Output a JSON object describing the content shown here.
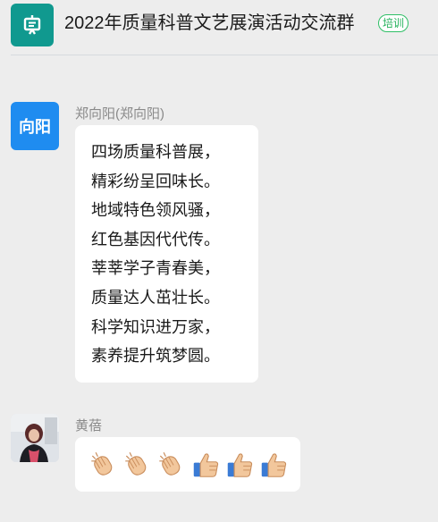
{
  "header": {
    "title": "2022年质量科普文艺展演活动交流群",
    "tag": "培训"
  },
  "messages": [
    {
      "avatar_text": "向阳",
      "sender": "郑向阳(郑向阳)",
      "lines": [
        "四场质量科普展，",
        "精彩纷呈回味长。",
        "地域特色领风骚，",
        "红色基因代代传。",
        "莘莘学子青春美，",
        "质量达人茁壮长。",
        "科学知识进万家，",
        "素养提升筑梦圆。"
      ]
    },
    {
      "sender": "黄蓓",
      "emojis": [
        "clapping-hands-icon",
        "clapping-hands-icon",
        "clapping-hands-icon",
        "thumbs-up-icon",
        "thumbs-up-icon",
        "thumbs-up-icon"
      ]
    }
  ],
  "colors": {
    "background": "#ededed",
    "group_icon": "#10998f",
    "avatar_blue": "#1f8cf0",
    "tag_green": "#23b05a"
  }
}
